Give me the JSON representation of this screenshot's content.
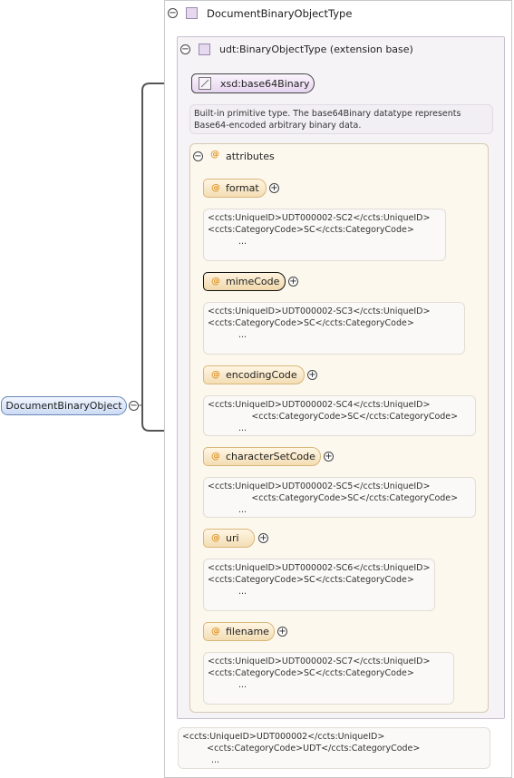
{
  "root": {
    "label": "DocumentBinaryObject"
  },
  "type_panel": {
    "title": "DocumentBinaryObjectType"
  },
  "ext_panel": {
    "title": "udt:BinaryObjectType (extension base)"
  },
  "base_type": {
    "label": "xsd:base64Binary",
    "doc": [
      "Built-in primitive type. The base64Binary datatype represents",
      "Base64-encoded arbitrary binary data."
    ]
  },
  "attributes_group": {
    "title": "attributes",
    "at_symbol": "@"
  },
  "attributes": [
    {
      "name": "format",
      "doc": [
        "<ccts:UniqueID>UDT000002-SC2</ccts:UniqueID>",
        "",
        "<ccts:CategoryCode>SC</ccts:CategoryCode>"
      ],
      "more": "..."
    },
    {
      "name": "mimeCode",
      "doc": [
        "<ccts:UniqueID>UDT000002-SC3</ccts:UniqueID>",
        "",
        "<ccts:CategoryCode>SC</ccts:CategoryCode>"
      ],
      "more": "..."
    },
    {
      "name": "encodingCode",
      "doc": [
        "<ccts:UniqueID>UDT000002-SC4</ccts:UniqueID>",
        "                <ccts:CategoryCode>SC</ccts:CategoryCode>"
      ],
      "more": "..."
    },
    {
      "name": "characterSetCode",
      "doc": [
        "<ccts:UniqueID>UDT000002-SC5</ccts:UniqueID>",
        "                <ccts:CategoryCode>SC</ccts:CategoryCode>"
      ],
      "more": "..."
    },
    {
      "name": "uri",
      "doc": [
        "<ccts:UniqueID>UDT000002-SC6</ccts:UniqueID>",
        "",
        "<ccts:CategoryCode>SC</ccts:CategoryCode>"
      ],
      "more": "..."
    },
    {
      "name": "filename",
      "doc": [
        "<ccts:UniqueID>UDT000002-SC7</ccts:UniqueID>",
        "",
        "<ccts:CategoryCode>SC</ccts:CategoryCode>"
      ],
      "more": "..."
    }
  ],
  "type_doc": {
    "lines": [
      "<ccts:UniqueID>UDT000002</ccts:UniqueID>",
      "         <ccts:CategoryCode>UDT</ccts:CategoryCode>"
    ],
    "more": "..."
  },
  "toggles": {
    "collapse": "−",
    "expand": "+"
  }
}
